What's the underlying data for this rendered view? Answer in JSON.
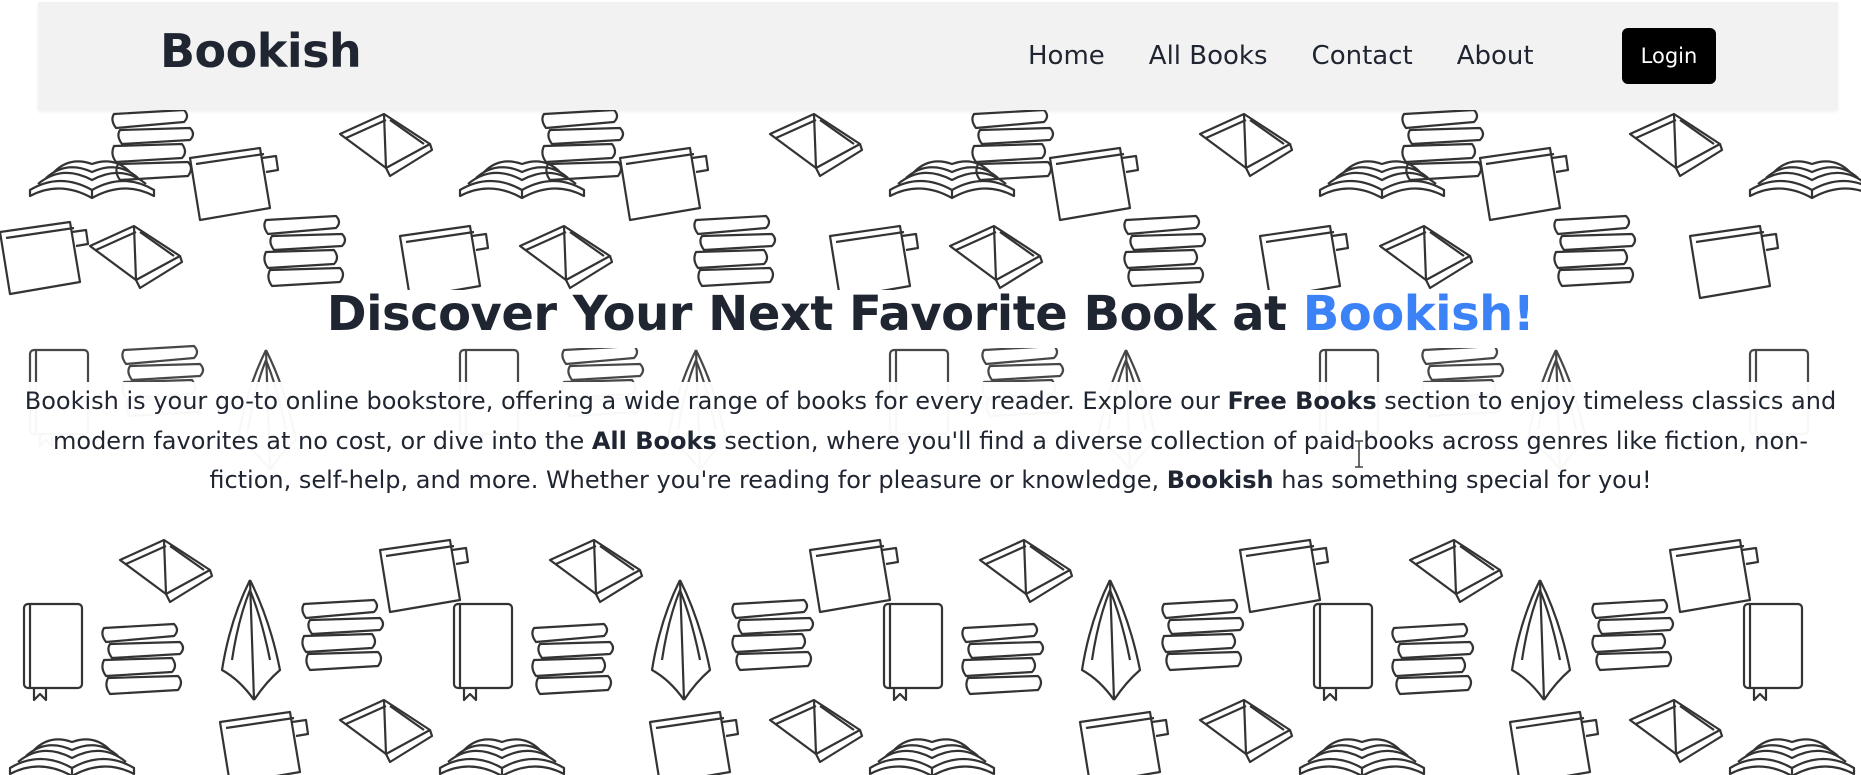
{
  "navbar": {
    "brand": "Bookish",
    "links": [
      "Home",
      "All Books",
      "Contact",
      "About"
    ],
    "login_label": "Login"
  },
  "hero": {
    "title_main": "Discover Your Next Favorite Book at ",
    "title_accent": "Bookish!",
    "para_1": "Bookish is your go-to online bookstore, offering a wide range of books for every reader. Explore our ",
    "bold_1": "Free Books",
    "para_2": " section to enjoy timeless classics and modern favorites at no cost, or dive into the ",
    "bold_2": "All Books",
    "para_3": " section, where you'll find a diverse collection of paid books across genres like fiction, non-fiction, self-help, and more. Whether you're reading for pleasure or knowledge, ",
    "bold_3": "Bookish",
    "para_4": " has something special for you!"
  },
  "colors": {
    "accent": "#3b82f6",
    "text": "#1f2531",
    "navbar_bg": "#f2f2f2",
    "button_bg": "#000000"
  },
  "icons": [
    "open-book-icon",
    "closed-book-icon",
    "book-stack-icon",
    "notebook-icon"
  ]
}
